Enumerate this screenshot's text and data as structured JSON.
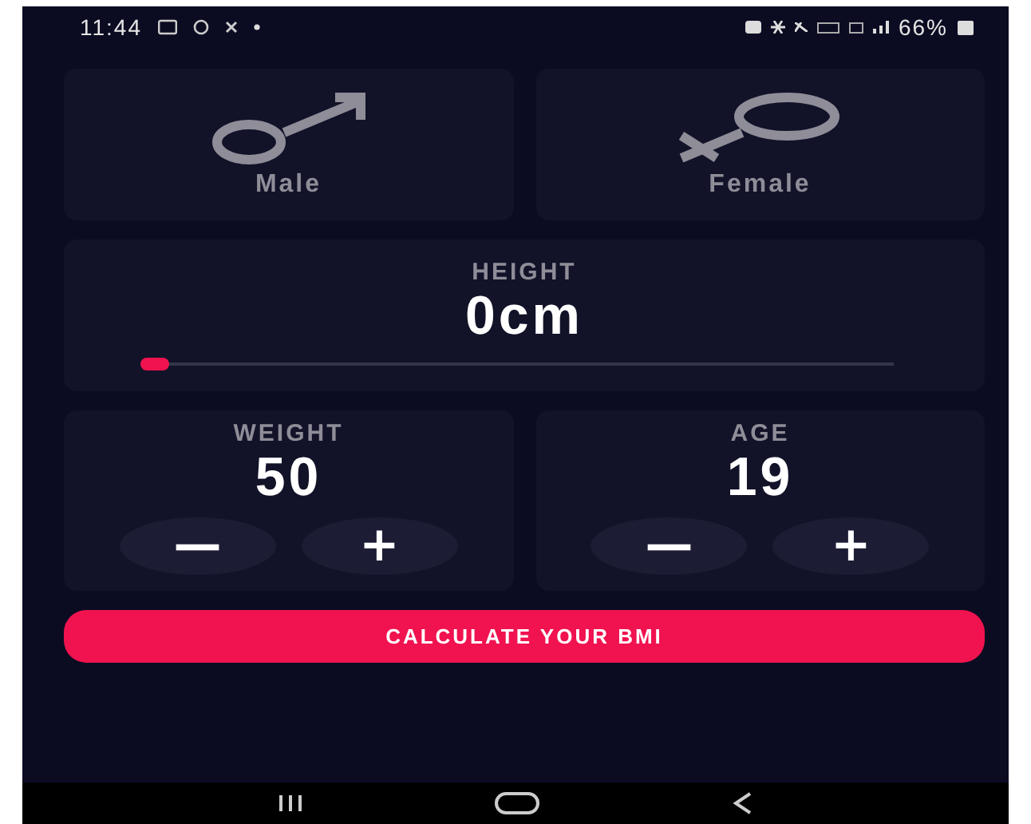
{
  "status_bar": {
    "time": "11:44",
    "battery": "66%"
  },
  "genders": [
    {
      "label": "Male",
      "kind": "male",
      "selected": false
    },
    {
      "label": "Female",
      "kind": "female",
      "selected": false
    }
  ],
  "height": {
    "label": "HEIGHT",
    "value": "0cm",
    "level": 0
  },
  "counters": [
    {
      "label": "WEIGHT",
      "value": "50",
      "decrement": "—",
      "increment": "+"
    },
    {
      "label": "AGE",
      "value": "19",
      "decrement": "—",
      "increment": "+"
    }
  ],
  "calculate_button": "CALCULATE YOUR BMI"
}
